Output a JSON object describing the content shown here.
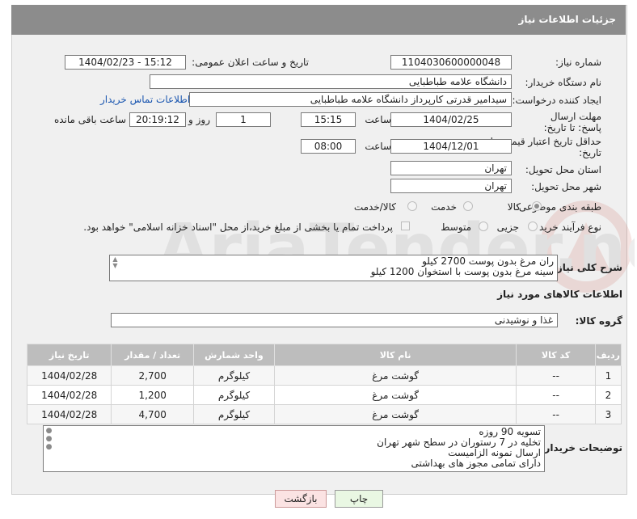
{
  "header": {
    "title": "جزئیات اطلاعات نیاز"
  },
  "fields": {
    "need_number_label": "شماره نیاز:",
    "need_number": "1104030600000048",
    "announce_label": "تاریخ و ساعت اعلان عمومی:",
    "announce_value": "1404/02/23 - 15:12",
    "buyer_label": "نام دستگاه خریدار:",
    "buyer_value": "دانشگاه علامه طباطبایی",
    "creator_label": "ایجاد کننده درخواست:",
    "creator_value": "سیدامیر قدرتی کارپرداز دانشگاه علامه طباطبایی",
    "contact_link": "اطلاعات تماس خریدار",
    "reply_deadline_label": "مهلت ارسال پاسخ: تا تاریخ:",
    "reply_date": "1404/02/25",
    "time_label": "ساعت",
    "reply_time": "15:15",
    "days": "1",
    "day_and_label": "روز و",
    "remaining": "20:19:12",
    "remaining_label": "ساعت باقی مانده",
    "price_deadline_label": "حداقل تاریخ اعتبار قیمت: تا تاریخ:",
    "price_date": "1404/12/01",
    "price_time": "08:00",
    "province_label": "استان محل تحویل:",
    "province_value": "تهران",
    "city_label": "شهر محل تحویل:",
    "city_value": "تهران",
    "category_label": "طبقه بندی موضوعی:",
    "category_options": [
      "کالا",
      "خدمت",
      "کالا/خدمت"
    ],
    "process_label": "نوع فرآیند خرید :",
    "process_options": [
      "جزیی",
      "متوسط"
    ],
    "payment_note": "پرداخت تمام یا بخشی از مبلغ خرید،از محل \"اسناد خزانه اسلامی\" خواهد بود.",
    "summary_label": "شرح کلی نیاز:",
    "summary_lines": [
      "ران مرغ بدون پوست 2700 کیلو",
      "سینه مرغ بدون پوست با استخوان 1200 کیلو"
    ],
    "goods_section_title": "اطلاعات کالاهای مورد نیاز",
    "group_label": "گروه کالا:",
    "group_value": "غذا و نوشیدنی"
  },
  "table": {
    "headers": [
      "ردیف",
      "کد کالا",
      "نام کالا",
      "واحد شمارش",
      "تعداد / مقدار",
      "تاریخ نیاز"
    ],
    "rows": [
      [
        "1",
        "--",
        "گوشت مرغ",
        "کیلوگرم",
        "2,700",
        "1404/02/28"
      ],
      [
        "2",
        "--",
        "گوشت مرغ",
        "کیلوگرم",
        "1,200",
        "1404/02/28"
      ],
      [
        "3",
        "--",
        "گوشت مرغ",
        "کیلوگرم",
        "4,700",
        "1404/02/28"
      ]
    ]
  },
  "notes": {
    "label": "توضیحات خریدار:",
    "lines": [
      "تسویه 90 روزه",
      "تخلیه در 7 رستوران در سطح شهر تهران",
      "ارسال نمونه الزامیست",
      "دارای تمامی مجوز های بهداشتی"
    ]
  },
  "buttons": {
    "print": "چاپ",
    "back": "بازگشت"
  },
  "colors": {
    "header_bg": "#8c8c8c",
    "link": "#1a56b0",
    "print_bg": "#e9f7e3",
    "back_bg": "#fbe3e3"
  }
}
